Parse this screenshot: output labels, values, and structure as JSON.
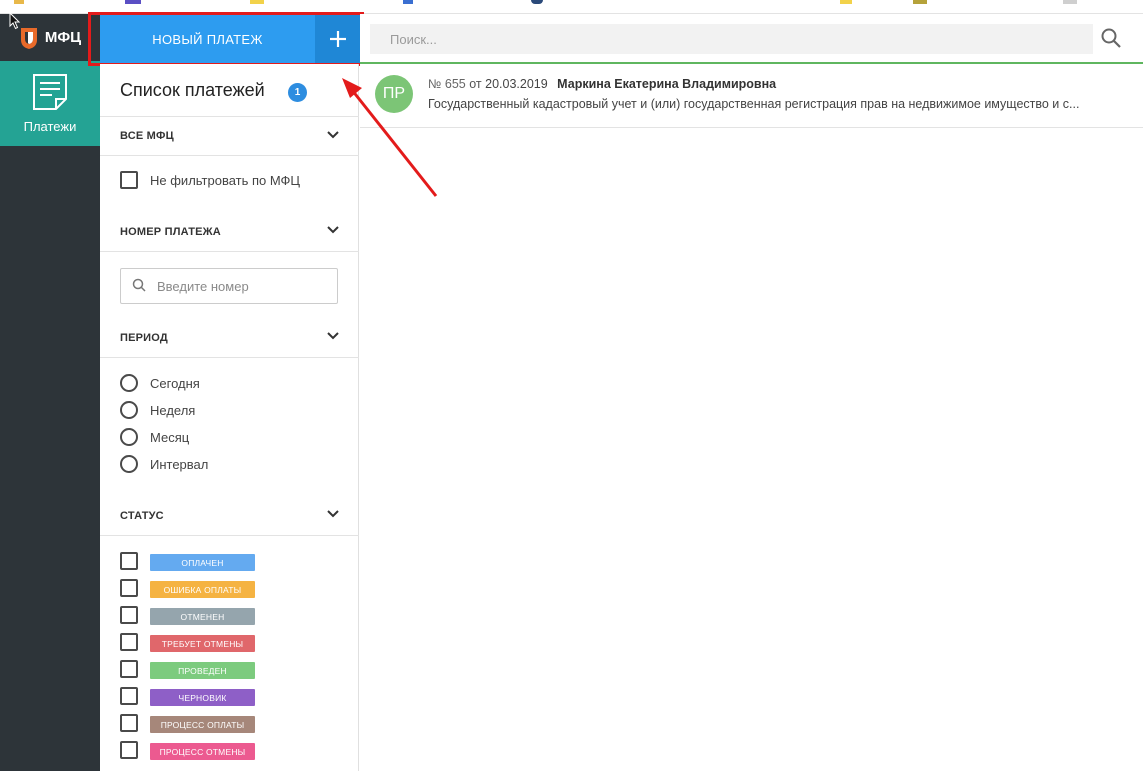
{
  "app": {
    "logo_text": "МФЦ"
  },
  "rail": {
    "nav_items": [
      {
        "label": "Платежи",
        "icon": "document-icon",
        "active": true
      }
    ]
  },
  "header": {
    "new_payment_label": "НОВЫЙ ПЛАТЕЖ",
    "add_symbol": "+",
    "search_placeholder": "Поиск..."
  },
  "filters": {
    "title": "Список платежей",
    "count": "1",
    "sections": {
      "mfc": {
        "label": "ВСЕ МФЦ",
        "checkbox_label": "Не фильтровать по МФЦ"
      },
      "number": {
        "label": "НОМЕР ПЛАТЕЖА",
        "input_placeholder": "Введите номер"
      },
      "period": {
        "label": "ПЕРИОД",
        "options": [
          "Сегодня",
          "Неделя",
          "Месяц",
          "Интервал"
        ]
      },
      "status": {
        "label": "СТАТУС",
        "items": [
          {
            "label": "ОПЛАЧЕН",
            "color": "#64aaf0"
          },
          {
            "label": "ОШИБКА ОПЛАТЫ",
            "color": "#f5b342"
          },
          {
            "label": "ОТМЕНЕН",
            "color": "#95a5ad"
          },
          {
            "label": "ТРЕБУЕТ ОТМЕНЫ",
            "color": "#e0676b"
          },
          {
            "label": "ПРОВЕДЕН",
            "color": "#7ccb7e"
          },
          {
            "label": "ЧЕРНОВИК",
            "color": "#8e5fc7"
          },
          {
            "label": "ПРОЦЕСС ОПЛАТЫ",
            "color": "#a6877a"
          },
          {
            "label": "ПРОЦЕСС ОТМЕНЫ",
            "color": "#ec5a90"
          }
        ]
      }
    }
  },
  "payments": [
    {
      "avatar_initials": "ПР",
      "avatar_color": "#7cc576",
      "number": "№ 655",
      "from_word": "от",
      "date": "20.03.2019",
      "name": "Маркина Екатерина Владимировна",
      "description": "Государственный кадастровый учет и (или) государственная регистрация прав на недвижимое имущество и с..."
    }
  ],
  "colors": {
    "rail_bg": "#2d3439",
    "nav_active": "#24a394",
    "primary": "#2d9cf0",
    "highlight": "#e31b1b"
  }
}
